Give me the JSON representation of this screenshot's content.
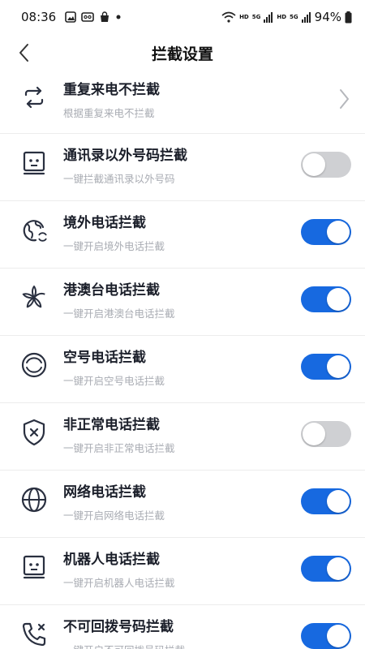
{
  "status_bar": {
    "time": "08:36",
    "battery": "94%",
    "network_labels": [
      "HD",
      "5G",
      "HD",
      "5G"
    ]
  },
  "header": {
    "title": "拦截设置"
  },
  "colors": {
    "accent": "#1769e0",
    "toggle_off": "#cfd0d3",
    "icon": "#2a3040"
  },
  "items": [
    {
      "title": "重复来电不拦截",
      "subtitle": "根据重复来电不拦截",
      "control": "chevron",
      "icon": "repeat-icon"
    },
    {
      "title": "通讯录以外号码拦截",
      "subtitle": "一键拦截通讯录以外号码",
      "control": "toggle",
      "enabled": false,
      "icon": "robot-face-icon"
    },
    {
      "title": "境外电话拦截",
      "subtitle": "一键开启境外电话拦截",
      "control": "toggle",
      "enabled": true,
      "icon": "globe-refresh-icon"
    },
    {
      "title": "港澳台电话拦截",
      "subtitle": "一键开启港澳台电话拦截",
      "control": "toggle",
      "enabled": true,
      "icon": "bauhinia-flower-icon"
    },
    {
      "title": "空号电话拦截",
      "subtitle": "一键开启空号电话拦截",
      "control": "toggle",
      "enabled": true,
      "icon": "empty-circle-icon"
    },
    {
      "title": "非正常电话拦截",
      "subtitle": "一键开启非正常电话拦截",
      "control": "toggle",
      "enabled": false,
      "icon": "shield-x-icon"
    },
    {
      "title": "网络电话拦截",
      "subtitle": "一键开启网络电话拦截",
      "control": "toggle",
      "enabled": true,
      "icon": "globe-icon"
    },
    {
      "title": "机器人电话拦截",
      "subtitle": "一键开启机器人电话拦截",
      "control": "toggle",
      "enabled": true,
      "icon": "robot-face-icon"
    },
    {
      "title": "不可回拨号码拦截",
      "subtitle": "一键开启不可回拨号码拦截",
      "control": "toggle",
      "enabled": true,
      "icon": "phone-blocked-icon"
    }
  ]
}
